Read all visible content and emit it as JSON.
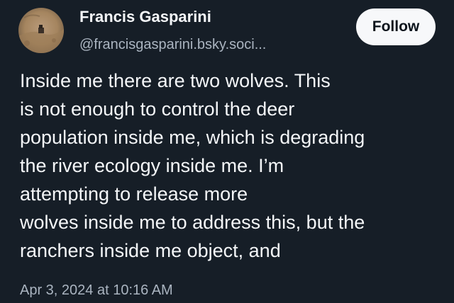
{
  "author": {
    "display_name": "Francis Gasparini",
    "handle": "@francisgasparini.bsky.soci...",
    "avatar_icon": "profile-photo"
  },
  "follow_button": {
    "label": "Follow"
  },
  "post": {
    "lines": [
      "Inside me there are two wolves. This",
      "is not enough to control the deer",
      "population inside me, which is degrading",
      "the river ecology inside me. I’m",
      "attempting to release more",
      "wolves inside me to address this, but the",
      "ranchers inside me object, and"
    ],
    "timestamp": "Apr 3, 2024 at 10:16 AM"
  },
  "colors": {
    "background": "#161e27",
    "text_primary": "#f4f6f8",
    "text_secondary": "#aab4c0",
    "button_bg": "#f7f8fa",
    "button_text": "#0c141c"
  }
}
